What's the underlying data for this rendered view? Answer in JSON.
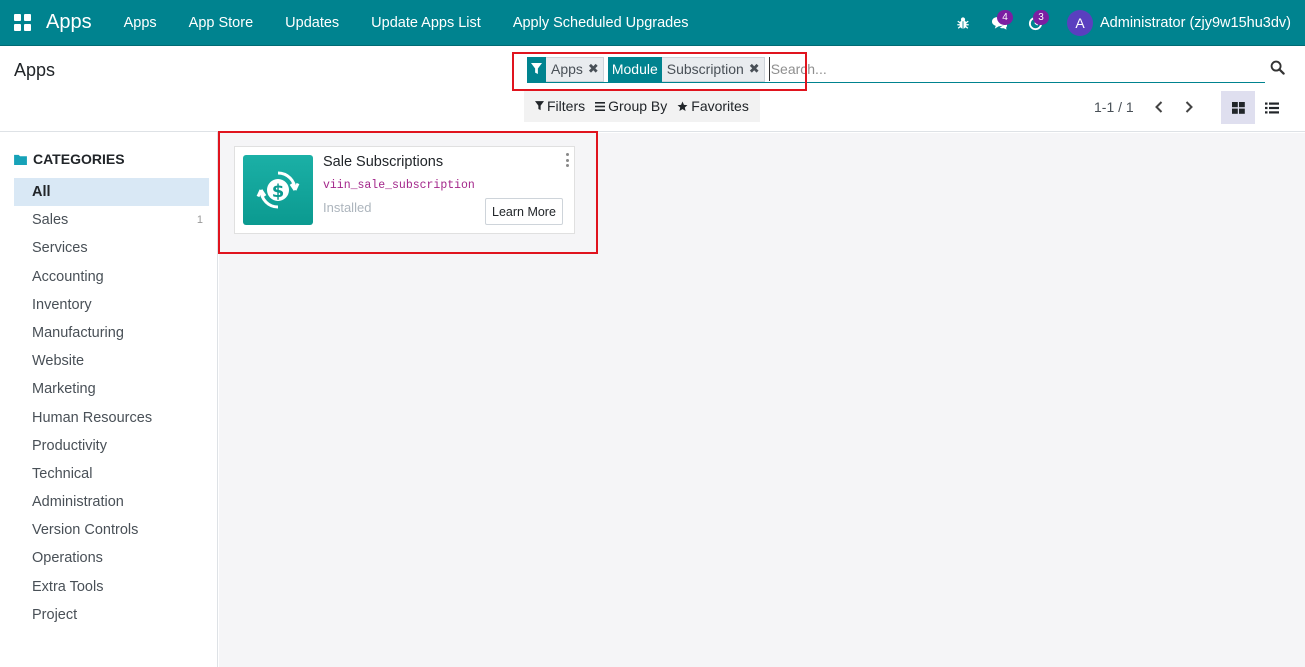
{
  "navbar": {
    "brand": "Apps",
    "menu_items": [
      "Apps",
      "App Store",
      "Updates",
      "Update Apps List",
      "Apply Scheduled Upgrades"
    ],
    "messages_count": "4",
    "activities_count": "3",
    "user_initial": "A",
    "user_name": "Administrator (zjy9w15hu3dv)"
  },
  "control_panel": {
    "breadcrumb": "Apps",
    "search": {
      "facet_filter_value": "Apps",
      "facet_module_label": "Module",
      "facet_module_value": "Subscription",
      "placeholder": "Search..."
    },
    "filters_label": "Filters",
    "group_by_label": "Group By",
    "favorites_label": "Favorites",
    "pager": "1-1 / 1"
  },
  "sidebar": {
    "header": "CATEGORIES",
    "categories": [
      {
        "label": "All",
        "count": ""
      },
      {
        "label": "Sales",
        "count": "1"
      },
      {
        "label": "Services",
        "count": ""
      },
      {
        "label": "Accounting",
        "count": ""
      },
      {
        "label": "Inventory",
        "count": ""
      },
      {
        "label": "Manufacturing",
        "count": ""
      },
      {
        "label": "Website",
        "count": ""
      },
      {
        "label": "Marketing",
        "count": ""
      },
      {
        "label": "Human Resources",
        "count": ""
      },
      {
        "label": "Productivity",
        "count": ""
      },
      {
        "label": "Technical",
        "count": ""
      },
      {
        "label": "Administration",
        "count": ""
      },
      {
        "label": "Version Controls",
        "count": ""
      },
      {
        "label": "Operations",
        "count": ""
      },
      {
        "label": "Extra Tools",
        "count": ""
      },
      {
        "label": "Project",
        "count": ""
      }
    ]
  },
  "app_card": {
    "name": "Sale Subscriptions",
    "technical_name": "viin_sale_subscription",
    "status": "Installed",
    "learn_more_label": "Learn More",
    "icon": "dollar-refresh-icon"
  },
  "colors": {
    "primary": "#00838f",
    "badge": "#7b1fa2",
    "highlight": "#e0141e"
  }
}
